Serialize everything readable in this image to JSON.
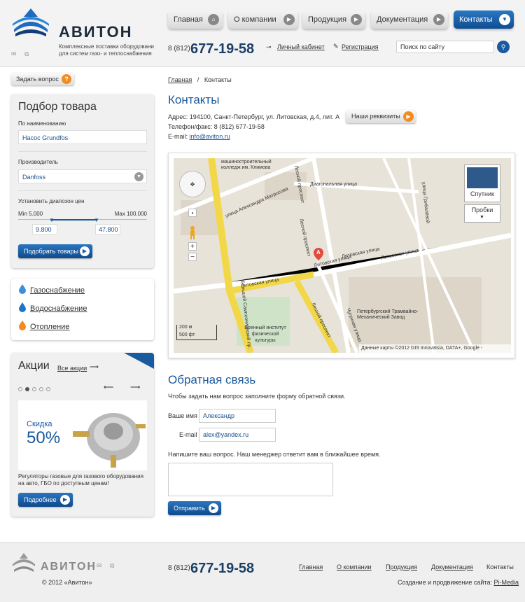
{
  "header": {
    "logo_text": "АВИТОН",
    "tagline_1": "Комплексные поставки оборудовани",
    "tagline_2": "для систем газо- и теплоснабжения",
    "phone_code": "8 (812)",
    "phone_number": "677-19-58",
    "cabinet_link": "Личный кабинет",
    "register_link": "Регистрация",
    "search_placeholder": "Поиск по сайту",
    "nav": [
      {
        "label": "Главная"
      },
      {
        "label": "О компании"
      },
      {
        "label": "Продукция"
      },
      {
        "label": "Документация"
      },
      {
        "label": "Контакты"
      }
    ]
  },
  "sidebar": {
    "ask_button": "Задать вопрос",
    "ask_icon": "?",
    "picker": {
      "title": "Подбор товара",
      "name_label": "По наименованию",
      "name_value": "Насос Grundfos",
      "maker_label": "Производитель",
      "maker_value": "Danfoss",
      "price_label": "Установить диапозон цен",
      "min_label": "Min 5.000",
      "max_label": "Max 100.000",
      "low_value": "9.800",
      "high_value": "47.800",
      "submit": "Подобрать товары"
    },
    "categories": [
      {
        "label": "Газоснабжение"
      },
      {
        "label": "Водоснабжение"
      },
      {
        "label": "Отопление"
      }
    ],
    "promo": {
      "title": "Акции",
      "all_link": "Все акции",
      "discount_label": "Скидка",
      "discount_value": "50%",
      "description_1": "Регуляторы газовые для газового оборудования",
      "description_2": "на авто, ГБО по доступным ценам!",
      "more": "Подробнее"
    }
  },
  "content": {
    "breadcrumb_home": "Главная",
    "breadcrumb_sep": "/",
    "breadcrumb_current": "Контакты",
    "title": "Контакты",
    "address": "Адрес: 194100, Санкт-Петербург, ул. Литовская, д.4, лит. А",
    "phone": "Телефон/факс: 8 (812) 677-19-58",
    "email_label": "E-mail:",
    "email": "info@aviton.ru",
    "requisites_button": "Наши реквизиты",
    "map": {
      "satellite": "Спутник",
      "traffic": "Пробки",
      "scale_m": "200 м",
      "scale_ft": "500 фт",
      "attribution": "Данные карты ©2012 GIS Innovatsia, DATA+, Google -",
      "marker": "A",
      "streets": {
        "s1": "машиностроительный колледж им. Климова",
        "s2": "улица Александра Матросова",
        "s3": "Диагональная улица",
        "s4": "Литовская улица",
        "s5": "Литовская улица",
        "s6": "Литовская улица",
        "s7": "Чугунная улица",
        "s8": "Лесной проспект",
        "s9": "Военный институт физической культуры",
        "s10": "Петербургский Трамвайно-Механический Завод",
        "s11": "Лесной проспект",
        "s12": "Большой Сампсониевский пр.",
        "s13": "улица Грибалёвой",
        "s14": "Литовская улица",
        "s15": "Лесной проспект"
      }
    },
    "feedback": {
      "title": "Обратная связь",
      "intro": "Чтобы задать нам вопрос заполните форму обратной связи.",
      "name_label": "Ваше имя",
      "name_value": "Александр",
      "email_label": "E-mail",
      "email_value": "alex@yandex.ru",
      "question_label": "Напишите ваш вопрос. Наш менеджер ответит вам в ближайшее время.",
      "submit": "Отправить"
    }
  },
  "footer": {
    "logo_text": "АВИТОН",
    "copyright": "© 2012 «Авитон»",
    "phone_code": "8 (812)",
    "phone_number": "677-19-58",
    "links": [
      {
        "label": "Главная"
      },
      {
        "label": "О компании"
      },
      {
        "label": "Продукция"
      },
      {
        "label": "Документация"
      },
      {
        "label": "Контакты"
      }
    ],
    "credit_text": "Создание и продвижение сайта:",
    "credit_link": "Pi-Media"
  },
  "colors": {
    "brand_blue": "#1a5a9e",
    "accent_orange": "#f28c1e"
  }
}
